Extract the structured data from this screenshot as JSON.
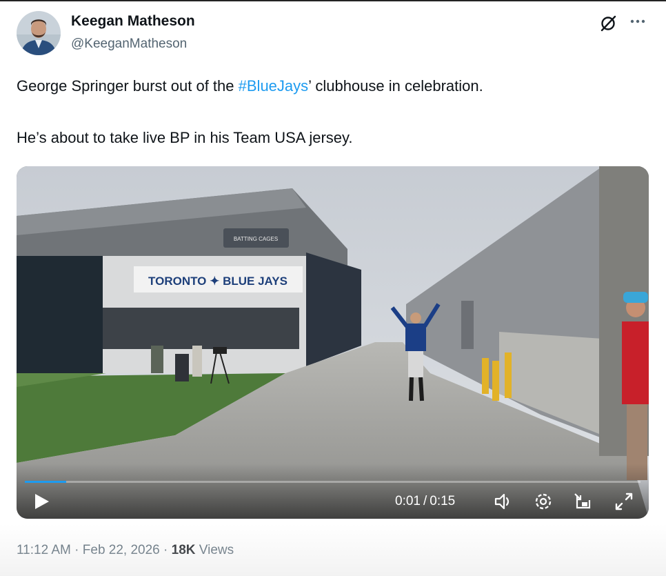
{
  "author": {
    "display_name": "Keegan Matheson",
    "handle": "@KeeganMatheson",
    "avatar_icon": "person-avatar"
  },
  "header_icons": {
    "grok": "grok-icon",
    "more": "more-options-icon"
  },
  "tweet": {
    "line1_before": "George Springer burst out of the ",
    "line1_hashtag": "#BlueJays",
    "line1_after": "’ clubhouse in celebration.",
    "line2": "He’s about to take live BP in his Team USA jersey."
  },
  "video": {
    "building_sign": "TORONTO ✦ BLUE JAYS",
    "roof_sign": "BATTING CAGES",
    "current_time": "0:01",
    "duration": "0:15",
    "time_separator": "/",
    "progress_fraction": 0.067,
    "icons": {
      "play": "play-icon",
      "volume": "volume-icon",
      "settings": "settings-icon",
      "pip": "picture-in-picture-icon",
      "fullscreen": "fullscreen-icon"
    }
  },
  "meta": {
    "time": "11:12 AM",
    "date": "Feb 22, 2026",
    "separator": "·",
    "views_count": "18K",
    "views_label": "Views"
  },
  "colors": {
    "accent": "#1d9bf0",
    "text": "#0f1419",
    "muted": "#536471"
  }
}
